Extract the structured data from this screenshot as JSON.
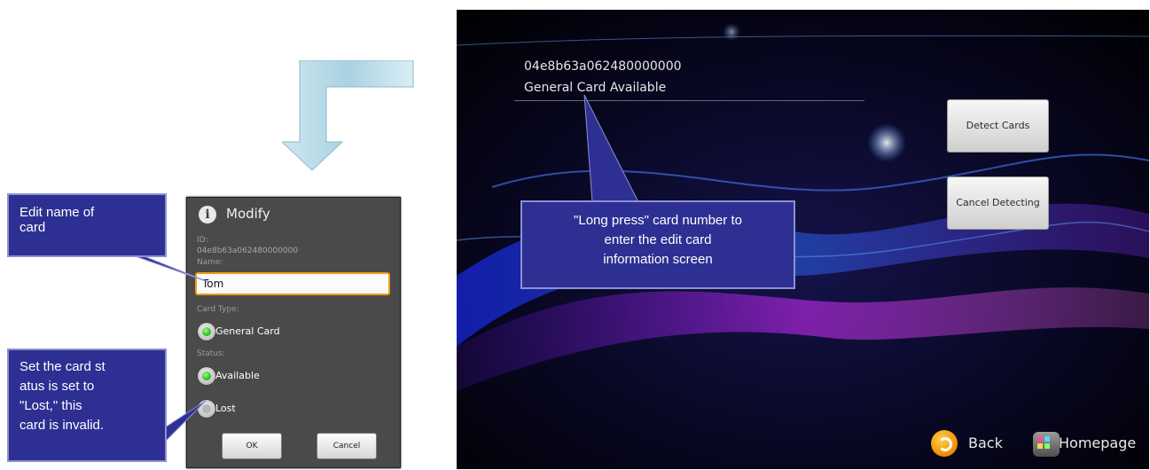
{
  "dialog": {
    "title": "Modify",
    "id_label": "ID:",
    "id_value": "04e8b63a062480000000",
    "name_label": "Name:",
    "name_value": "Tom",
    "card_type_label": "Card Type:",
    "card_type_option": "General Card",
    "status_label": "Status:",
    "status_options": [
      "Available",
      "Lost"
    ],
    "ok_label": "OK",
    "cancel_label": "Cancel"
  },
  "callouts": {
    "edit_name": [
      "Edit name of",
      "card"
    ],
    "set_status": [
      "Set the card st",
      "atus is set to",
      "\"Lost,\" this",
      "card is invalid."
    ],
    "long_press": [
      "\"Long press\" card number to",
      "enter the edit card",
      "information screen"
    ]
  },
  "screen": {
    "card_number": "04e8b63a062480000000",
    "card_info": "General Card  Available",
    "detect_label": "Detect Cards",
    "cancel_detect_label": "Cancel Detecting",
    "back_label": "Back",
    "home_label": "Homepage"
  },
  "colors": {
    "callout_bg": "#2d2f92",
    "input_focus_border": "#f19a1b",
    "radio_selected": "#1eb41e",
    "arrow_fill": "#b7dbe8"
  },
  "icons": [
    "info-icon",
    "back-icon",
    "homepage-icon",
    "arrow-down-icon"
  ]
}
